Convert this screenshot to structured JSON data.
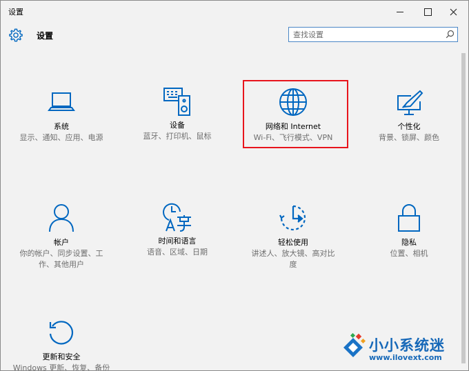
{
  "window": {
    "title": "设置",
    "controls": {
      "minimize": "—",
      "maximize": "☐",
      "close": "✕"
    }
  },
  "header": {
    "title": "设置",
    "search": {
      "placeholder": "查找设置"
    }
  },
  "colors": {
    "accent": "#0067c0",
    "highlight": "#e8141c",
    "brand": "#1668b8"
  },
  "tiles": [
    {
      "id": "system",
      "icon": "laptop-icon",
      "label": "系统",
      "desc": "显示、通知、应用、电源"
    },
    {
      "id": "devices",
      "icon": "devices-icon",
      "label": "设备",
      "desc": "蓝牙、打印机、鼠标"
    },
    {
      "id": "network",
      "icon": "globe-icon",
      "label": "网络和 Internet",
      "desc": "Wi-Fi、飞行模式、VPN"
    },
    {
      "id": "personalization",
      "icon": "paint-monitor-icon",
      "label": "个性化",
      "desc": "背景、锁屏、颜色"
    },
    {
      "id": "accounts",
      "icon": "person-icon",
      "label": "帐户",
      "desc": "你的帐户、同步设置、工作、其他用户"
    },
    {
      "id": "time-language",
      "icon": "time-language-icon",
      "label": "时间和语言",
      "desc": "语音、区域、日期"
    },
    {
      "id": "ease-of-access",
      "icon": "ease-of-access-icon",
      "label": "轻松使用",
      "desc": "讲述人、放大镜、高对比度"
    },
    {
      "id": "privacy",
      "icon": "lock-icon",
      "label": "隐私",
      "desc": "位置、相机"
    },
    {
      "id": "update-security",
      "icon": "refresh-icon",
      "label": "更新和安全",
      "desc": "Windows 更新、恢复、备份"
    }
  ],
  "watermark": {
    "brand": "小小系统迷",
    "url": "www.ilovext.com"
  }
}
